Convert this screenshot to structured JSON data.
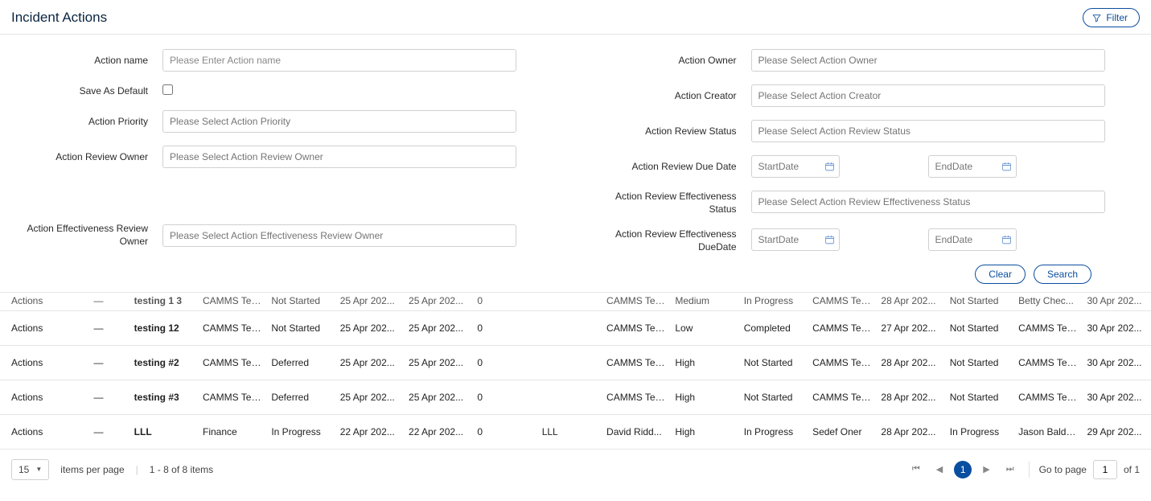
{
  "header": {
    "title": "Incident Actions",
    "filter_btn": "Filter"
  },
  "filters": {
    "left": {
      "action_name": {
        "label": "Action name",
        "placeholder": "Please Enter Action name"
      },
      "save_default": {
        "label": "Save As Default"
      },
      "action_priority": {
        "label": "Action Priority",
        "placeholder": "Please Select Action Priority"
      },
      "review_owner": {
        "label": "Action Review Owner",
        "placeholder": "Please Select Action Review Owner"
      },
      "eff_review_owner": {
        "label": "Action Effectiveness Review Owner",
        "placeholder": "Please Select Action Effectiveness Review Owner"
      }
    },
    "right": {
      "action_owner": {
        "label": "Action Owner",
        "placeholder": "Please Select Action Owner"
      },
      "action_creator": {
        "label": "Action Creator",
        "placeholder": "Please Select Action Creator"
      },
      "review_status": {
        "label": "Action Review Status",
        "placeholder": "Please Select Action Review Status"
      },
      "review_due": {
        "label": "Action Review Due Date",
        "start": "StartDate",
        "end": "EndDate"
      },
      "eff_status": {
        "label": "Action Review Effectiveness Status",
        "placeholder": "Please Select Action Review Effectiveness Status"
      },
      "eff_due": {
        "label": "Action Review Effectiveness DueDate",
        "start": "StartDate",
        "end": "EndDate"
      }
    },
    "buttons": {
      "clear": "Clear",
      "search": "Search"
    }
  },
  "rows": [
    {
      "cut": true,
      "c0": "Actions",
      "c1": "—",
      "c2": "testing 1 3",
      "c3": "CAMMS Tes...",
      "c4": "Not Started",
      "c5": "25 Apr 202...",
      "c6": "25 Apr 202...",
      "c7": "0",
      "c8": "",
      "c9": "CAMMS Tes...",
      "c10": "Medium",
      "c11": "In Progress",
      "c12": "CAMMS Tes...",
      "c13": "28 Apr 202...",
      "c14": "Not Started",
      "c15": "Betty Chec...",
      "c16": "30 Apr 202..."
    },
    {
      "c0": "Actions",
      "c1": "—",
      "c2": "testing 12",
      "c3": "CAMMS Tes...",
      "c4": "Not Started",
      "c5": "25 Apr 202...",
      "c6": "25 Apr 202...",
      "c7": "0",
      "c8": "",
      "c9": "CAMMS Tes...",
      "c10": "Low",
      "c11": "Completed",
      "c12": "CAMMS Tes...",
      "c13": "27 Apr 202...",
      "c14": "Not Started",
      "c15": "CAMMS Tes...",
      "c16": "30 Apr 202..."
    },
    {
      "c0": "Actions",
      "c1": "—",
      "c2": "testing #2",
      "c3": "CAMMS Tes...",
      "c4": "Deferred",
      "c5": "25 Apr 202...",
      "c6": "25 Apr 202...",
      "c7": "0",
      "c8": "",
      "c9": "CAMMS Tes...",
      "c10": "High",
      "c11": "Not Started",
      "c12": "CAMMS Tes...",
      "c13": "28 Apr 202...",
      "c14": "Not Started",
      "c15": "CAMMS Tes...",
      "c16": "30 Apr 202..."
    },
    {
      "c0": "Actions",
      "c1": "—",
      "c2": "testing #3",
      "c3": "CAMMS Tes...",
      "c4": "Deferred",
      "c5": "25 Apr 202...",
      "c6": "25 Apr 202...",
      "c7": "0",
      "c8": "",
      "c9": "CAMMS Tes...",
      "c10": "High",
      "c11": "Not Started",
      "c12": "CAMMS Tes...",
      "c13": "28 Apr 202...",
      "c14": "Not Started",
      "c15": "CAMMS Tes...",
      "c16": "30 Apr 202..."
    },
    {
      "c0": "Actions",
      "c1": "—",
      "c2": "LLL",
      "c3": "Finance",
      "c4": "In Progress",
      "c5": "22 Apr 202...",
      "c6": "22 Apr 202...",
      "c7": "0",
      "c8": "LLL",
      "c9": "David Ridd...",
      "c10": "High",
      "c11": "In Progress",
      "c12": "Sedef Oner",
      "c13": "28 Apr 202...",
      "c14": "In Progress",
      "c15": "Jason Baldrey",
      "c16": "29 Apr 202..."
    }
  ],
  "footer": {
    "page_size": "15",
    "items_per_page": "items per page",
    "range": "1 - 8 of 8 items",
    "goto_label": "Go to page",
    "goto_value": "1",
    "of_text": "of 1",
    "current_page": "1"
  }
}
